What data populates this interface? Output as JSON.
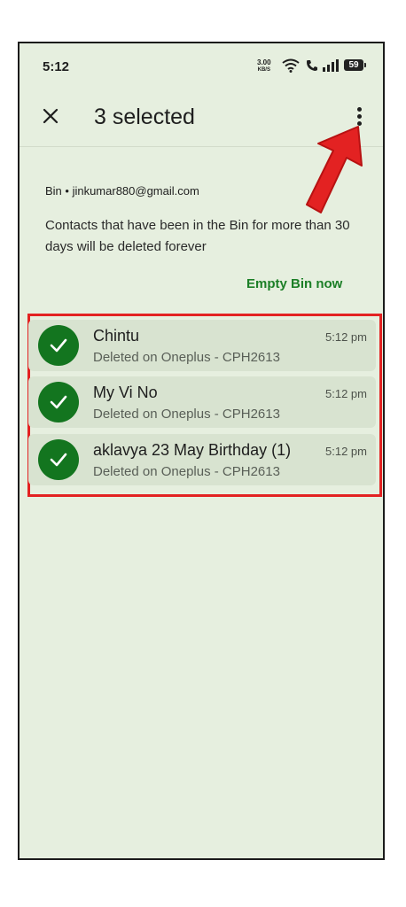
{
  "status_bar": {
    "time": "5:12",
    "speed_value": "3.00",
    "speed_unit": "KB/S",
    "battery": "59"
  },
  "header": {
    "title": "3 selected"
  },
  "account_line": "Bin • jinkumar880@gmail.com",
  "info_text": "Contacts that have been in the Bin for more than 30 days will be deleted forever",
  "empty_bin_label": "Empty Bin now",
  "contacts": [
    {
      "name": "Chintu",
      "subtitle": "Deleted on Oneplus - CPH2613",
      "time": "5:12 pm"
    },
    {
      "name": "My Vi No",
      "subtitle": "Deleted on Oneplus - CPH2613",
      "time": "5:12 pm"
    },
    {
      "name": "aklavya 23 May Birthday (1)",
      "subtitle": "Deleted on Oneplus - CPH2613",
      "time": "5:12 pm"
    }
  ],
  "colors": {
    "background": "#e6efdf",
    "accent_green": "#13751f",
    "link_green": "#1c7f27",
    "annotation_red": "#e32222"
  }
}
